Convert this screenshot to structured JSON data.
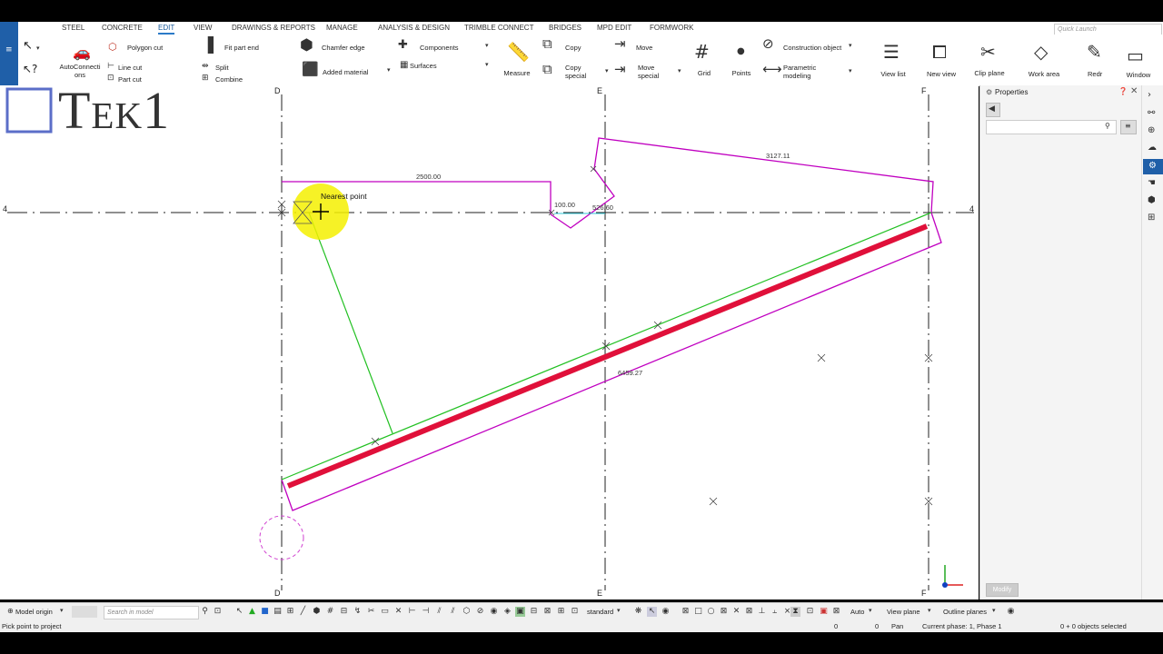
{
  "app": {
    "quick_launch_placeholder": "Quick Launch"
  },
  "tabs": [
    "STEEL",
    "CONCRETE",
    "EDIT",
    "VIEW",
    "DRAWINGS & REPORTS",
    "MANAGE",
    "ANALYSIS & DESIGN",
    "TRIMBLE CONNECT",
    "BRIDGES",
    "MPD EDIT",
    "FORMWORK"
  ],
  "active_tab": "EDIT",
  "ribbon": {
    "autoconnections_1": "AutoConnecti",
    "autoconnections_2": "ons",
    "polygon_cut": "Polygon cut",
    "line_cut": "Line cut",
    "part_cut": "Part cut",
    "fit_part_end": "Fit part end",
    "split": "Split",
    "combine": "Combine",
    "chamfer_edge": "Chamfer edge",
    "added_material": "Added material",
    "components": "Components",
    "surfaces": "Surfaces",
    "measure": "Measure",
    "copy": "Copy",
    "copy_special_1": "Copy",
    "copy_special_2": "special",
    "move": "Move",
    "move_special_1": "Move",
    "move_special_2": "special",
    "grid": "Grid",
    "points": "Points",
    "construction_object": "Construction object",
    "parametric_1": "Parametric",
    "parametric_2": "modeling",
    "view_list": "View list",
    "new_view": "New view",
    "clip_plane": "Clip plane",
    "work_area": "Work area",
    "redraw": "Redr",
    "window": "Window"
  },
  "logo_text": "Tek1",
  "canvas": {
    "grid_labels": {
      "d": "D",
      "e": "E",
      "f": "F",
      "row": "4"
    },
    "dims": {
      "d1": "2500.00",
      "d2": "3127.11",
      "d3": "100.00",
      "d4": "526.60",
      "d5": "6459.27"
    },
    "snap_tooltip": "Nearest point"
  },
  "properties": {
    "title": "Properties",
    "modify": "Modify"
  },
  "bottom": {
    "model_origin": "Model origin",
    "search_placeholder": "Search in model",
    "standard": "standard",
    "auto": "Auto",
    "view_plane": "View plane",
    "outline_planes": "Outline planes"
  },
  "status": {
    "prompt": "Pick point to project",
    "coord_x": "0",
    "coord_y": "0",
    "pan": "Pan",
    "phase": "Current phase: 1, Phase 1",
    "selected": "0 + 0 objects selected"
  }
}
